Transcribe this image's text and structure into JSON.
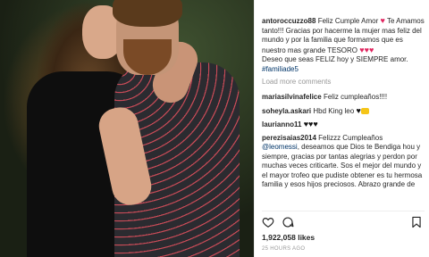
{
  "post": {
    "caption_user": "antoroccuzzo88",
    "caption_line1": "Feliz Cumple Amor",
    "caption_line1_end": "Te Amamos tanto!!! Gracias por hacerme la mujer mas feliz del mundo y por la familia que formamos que es nuestro mas grande TESORO",
    "caption_line2": "Deseo que seas FELIZ hoy y SIEMPRE amor.",
    "caption_hashtag": "#familiade5",
    "load_more": "Load more comments"
  },
  "comments": [
    {
      "user": "mariasilvinafelice",
      "text": "Feliz cumpleaños!!!!"
    },
    {
      "user": "soheyla.askari",
      "text": "Hbd King leo"
    },
    {
      "user": "laurianno11",
      "text": ""
    },
    {
      "user": "perezisaias2014",
      "text": "Felizzz Cumpleaños",
      "mention": "@leomessi",
      "text2": ", deseamos que Dios te Bendiga hou y siempre, gracias por tantas alegrias y perdon por muchas veces criticarte. Sos el mejor del mundo y el mayor trofeo que pudiste obtener es tu hermosa familia y esos hijos preciosos. Abrazo grande de"
    }
  ],
  "likes": {
    "count": "1,922,058",
    "label": "likes"
  },
  "time": "25 HOURS AGO",
  "icons": {
    "like": "heart-outline-icon",
    "comment": "speech-bubble-icon",
    "save": "bookmark-icon"
  },
  "colors": {
    "heart": "#e0245e",
    "link": "#003569",
    "muted": "#999999"
  }
}
